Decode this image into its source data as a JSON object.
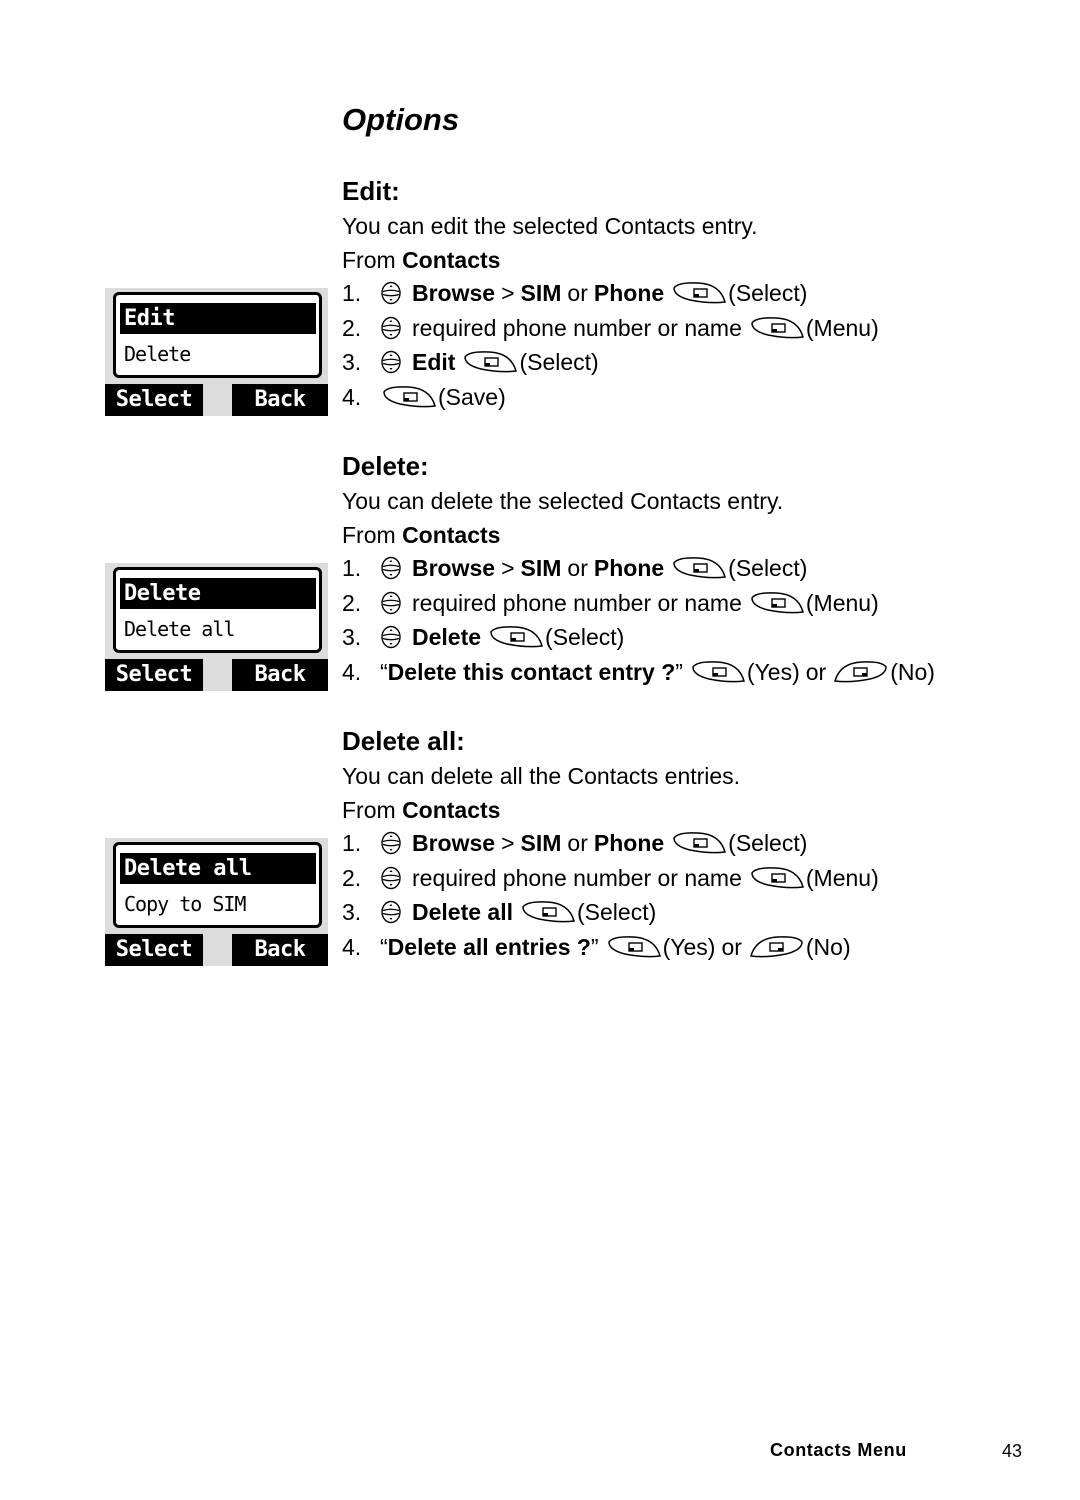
{
  "page": {
    "title": "Options",
    "footer": {
      "section": "Contacts Menu",
      "page_number": "43"
    }
  },
  "sections": [
    {
      "heading": "Edit:",
      "description": "You can edit the selected Contacts entry.",
      "from_prefix": "From",
      "from_menu": "Contacts",
      "phone_screen": {
        "selected_item": "Edit",
        "next_item": "Delete",
        "left_softkey": "Select",
        "right_softkey": "Back"
      },
      "steps": {
        "s1": {
          "num": "1.",
          "icon": "nav-key-icon",
          "browse": "Browse",
          "sep": ">",
          "sim": "SIM",
          "or": "or",
          "phone": "Phone",
          "key_icon": "left-softkey-icon",
          "action": "(Select)"
        },
        "s2": {
          "num": "2.",
          "icon": "nav-key-icon",
          "text": "required phone number or name",
          "key_icon": "left-softkey-icon",
          "action": "(Menu)"
        },
        "s3": {
          "num": "3.",
          "icon": "nav-key-icon",
          "item": "Edit",
          "key_icon": "left-softkey-icon",
          "action": "(Select)"
        },
        "s4": {
          "num": "4.",
          "key_icon": "left-softkey-icon",
          "action": "(Save)"
        }
      }
    },
    {
      "heading": "Delete:",
      "description": "You can delete the selected Contacts entry.",
      "from_prefix": "From",
      "from_menu": "Contacts",
      "phone_screen": {
        "selected_item": "Delete",
        "next_item": "Delete all",
        "left_softkey": "Select",
        "right_softkey": "Back"
      },
      "steps": {
        "s1": {
          "num": "1.",
          "icon": "nav-key-icon",
          "browse": "Browse",
          "sep": ">",
          "sim": "SIM",
          "or": "or",
          "phone": "Phone",
          "key_icon": "left-softkey-icon",
          "action": "(Select)"
        },
        "s2": {
          "num": "2.",
          "icon": "nav-key-icon",
          "text": "required phone number or name",
          "key_icon": "left-softkey-icon",
          "action": "(Menu)"
        },
        "s3": {
          "num": "3.",
          "icon": "nav-key-icon",
          "item": "Delete",
          "key_icon": "left-softkey-icon",
          "action": "(Select)"
        },
        "s4": {
          "num": "4.",
          "open_quote": "“",
          "prompt": "Delete this contact entry ?",
          "close_quote": "”",
          "yes_icon": "left-softkey-icon",
          "yes": "(Yes)",
          "or": "or",
          "no_icon": "right-softkey-icon",
          "no": "(No)"
        }
      }
    },
    {
      "heading": "Delete all:",
      "description": "You can delete all the Contacts entries.",
      "from_prefix": "From",
      "from_menu": "Contacts",
      "phone_screen": {
        "selected_item": "Delete all",
        "next_item": "Copy to SIM",
        "left_softkey": "Select",
        "right_softkey": "Back"
      },
      "steps": {
        "s1": {
          "num": "1.",
          "icon": "nav-key-icon",
          "browse": "Browse",
          "sep": ">",
          "sim": "SIM",
          "or": "or",
          "phone": "Phone",
          "key_icon": "left-softkey-icon",
          "action": "(Select)"
        },
        "s2": {
          "num": "2.",
          "icon": "nav-key-icon",
          "text": "required phone number or name",
          "key_icon": "left-softkey-icon",
          "action": "(Menu)"
        },
        "s3": {
          "num": "3.",
          "icon": "nav-key-icon",
          "item": "Delete all",
          "key_icon": "left-softkey-icon",
          "action": "(Select)"
        },
        "s4": {
          "num": "4.",
          "open_quote": "“",
          "prompt": "Delete all entries ?",
          "close_quote": "”",
          "yes_icon": "left-softkey-icon",
          "yes": "(Yes)",
          "or": "or",
          "no_icon": "right-softkey-icon",
          "no": "(No)"
        }
      }
    }
  ]
}
